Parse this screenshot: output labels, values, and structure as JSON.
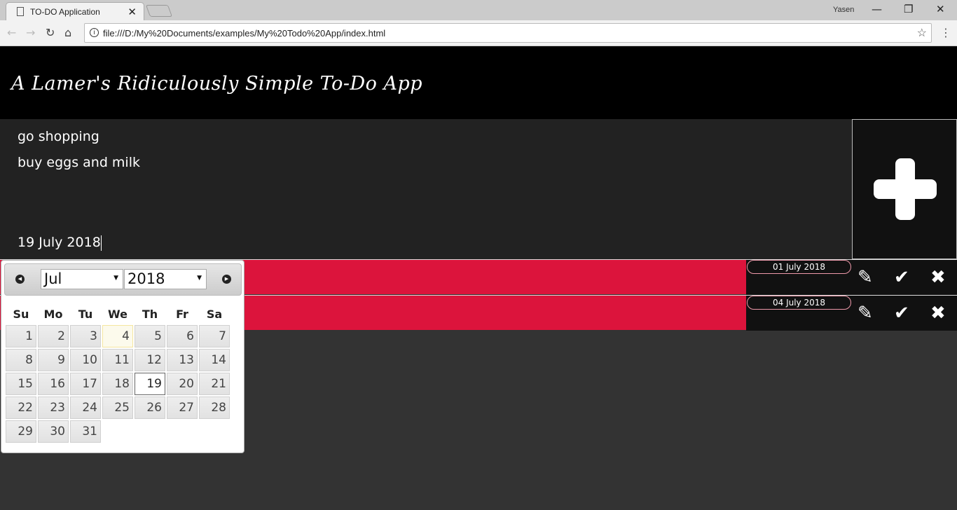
{
  "browser": {
    "tab_title": "TO-DO Application",
    "user": "Yasen",
    "url": "file:///D:/My%20Documents/examples/My%20Todo%20App/index.html"
  },
  "header": {
    "title": "A Lamer's Ridiculously Simple To-Do App"
  },
  "input": {
    "title": "go shopping",
    "description": "buy eggs and milk",
    "date": "19 July 2018"
  },
  "todos": [
    {
      "due": "01 July 2018"
    },
    {
      "due": "04 July 2018"
    }
  ],
  "colors": {
    "todo_row": "#dc143c",
    "header": "#000000",
    "input_bg": "#222222"
  },
  "datepicker": {
    "month": "Jul",
    "year": "2018",
    "weekdays": [
      "Su",
      "Mo",
      "Tu",
      "We",
      "Th",
      "Fr",
      "Sa"
    ],
    "weeks": [
      [
        "1",
        "2",
        "3",
        "4",
        "5",
        "6",
        "7"
      ],
      [
        "8",
        "9",
        "10",
        "11",
        "12",
        "13",
        "14"
      ],
      [
        "15",
        "16",
        "17",
        "18",
        "19",
        "20",
        "21"
      ],
      [
        "22",
        "23",
        "24",
        "25",
        "26",
        "27",
        "28"
      ],
      [
        "29",
        "30",
        "31",
        "",
        "",
        "",
        ""
      ]
    ],
    "today": "4",
    "selected": "19"
  }
}
